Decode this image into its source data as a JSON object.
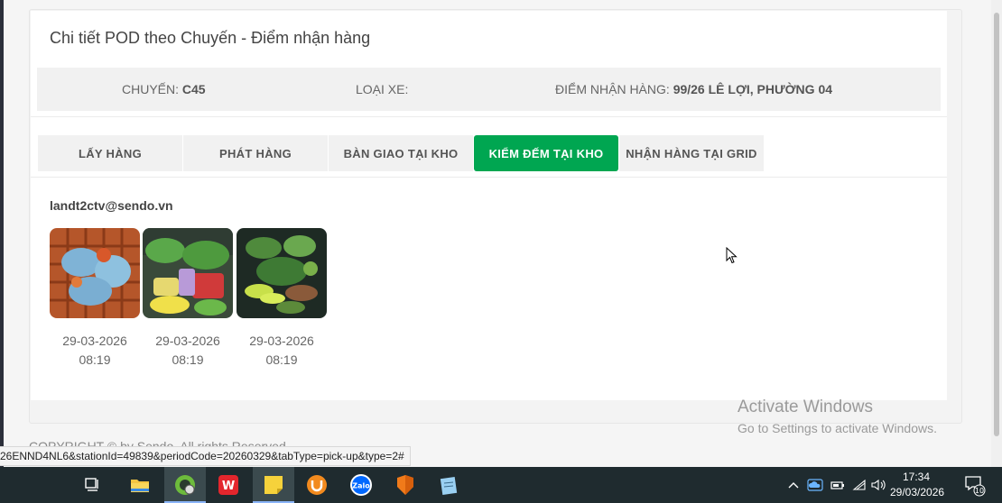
{
  "card": {
    "title": "Chi tiết POD theo Chuyến - Điểm nhận hàng"
  },
  "info": {
    "trip_label": "CHUYẾN:",
    "trip_value": "C45",
    "vehicle_label": "LOẠI XE:",
    "vehicle_value": "",
    "pickup_label": "ĐIỂM NHẬN HÀNG:",
    "pickup_value": "99/26 LÊ LỢI, PHƯỜNG 04"
  },
  "tabs": [
    {
      "label": "LẤY HÀNG",
      "active": false
    },
    {
      "label": "PHÁT HÀNG",
      "active": false
    },
    {
      "label": "BÀN GIAO TẠI KHO",
      "active": false
    },
    {
      "label": "KIỂM ĐẾM TẠI KHO",
      "active": true
    },
    {
      "label": "NHẬN HÀNG TẠI GRID",
      "active": false
    }
  ],
  "accent_color": "#00a651",
  "pod": {
    "user": "landt2ctv@sendo.vn",
    "photos": [
      {
        "date": "29-03-2026",
        "time": "08:19"
      },
      {
        "date": "29-03-2026",
        "time": "08:19"
      },
      {
        "date": "29-03-2026",
        "time": "08:19"
      }
    ]
  },
  "footer": {
    "copyright": "COPYRIGHT © by Sendo. All rights Reserved"
  },
  "status_bar": {
    "url": "26ENND4NL6&stationId=49839&periodCode=20260329&tabType=pick-up&type=2#"
  },
  "watermark": {
    "line1": "Activate Windows",
    "line2": "Go to Settings to activate Windows."
  },
  "taskbar": {
    "apps": [
      "task-view-icon",
      "file-explorer-icon",
      "coccoc-browser-icon",
      "wps-office-icon",
      "sticky-notes-icon",
      "ultraviewer-icon",
      "zalo-icon",
      "foxit-icon",
      "notepad-icon"
    ],
    "zalo_label": "Zalo",
    "clock_time": "17:34",
    "clock_date": "29/03/2026",
    "notification_count": "10"
  }
}
